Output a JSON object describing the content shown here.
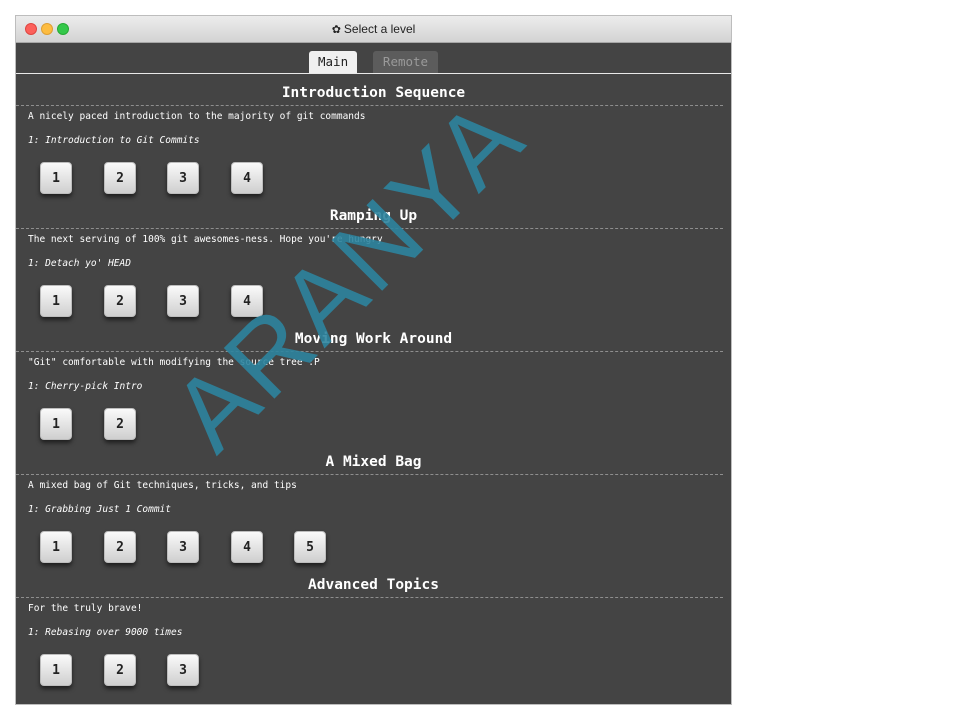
{
  "window": {
    "title": "Select a level",
    "title_icon": "gear-icon"
  },
  "tabs": [
    {
      "label": "Main",
      "active": true
    },
    {
      "label": "Remote",
      "active": false
    }
  ],
  "sections": [
    {
      "title": "Introduction Sequence",
      "description": "A nicely paced introduction to the majority of git commands",
      "subtitle": "1: Introduction to Git Commits",
      "levels": [
        "1",
        "2",
        "3",
        "4"
      ]
    },
    {
      "title": "Ramping Up",
      "description": "The next serving of 100% git awesomes-ness. Hope you're hungry",
      "subtitle": "1: Detach yo' HEAD",
      "levels": [
        "1",
        "2",
        "3",
        "4"
      ]
    },
    {
      "title": "Moving Work Around",
      "description": "\"Git\" comfortable with modifying the source tree :P",
      "subtitle": "1: Cherry-pick Intro",
      "levels": [
        "1",
        "2"
      ]
    },
    {
      "title": "A Mixed Bag",
      "description": "A mixed bag of Git techniques, tricks, and tips",
      "subtitle": "1: Grabbing Just 1 Commit",
      "levels": [
        "1",
        "2",
        "3",
        "4",
        "5"
      ]
    },
    {
      "title": "Advanced Topics",
      "description": "For the truly brave!",
      "subtitle": "1: Rebasing over 9000 times",
      "levels": [
        "1",
        "2",
        "3"
      ]
    }
  ],
  "watermark": "ARANYA",
  "colors": {
    "background": "#444444",
    "tab_active": "#f0f0f0",
    "tab_inactive": "#5c5c5c",
    "watermark": "#2e849e"
  }
}
